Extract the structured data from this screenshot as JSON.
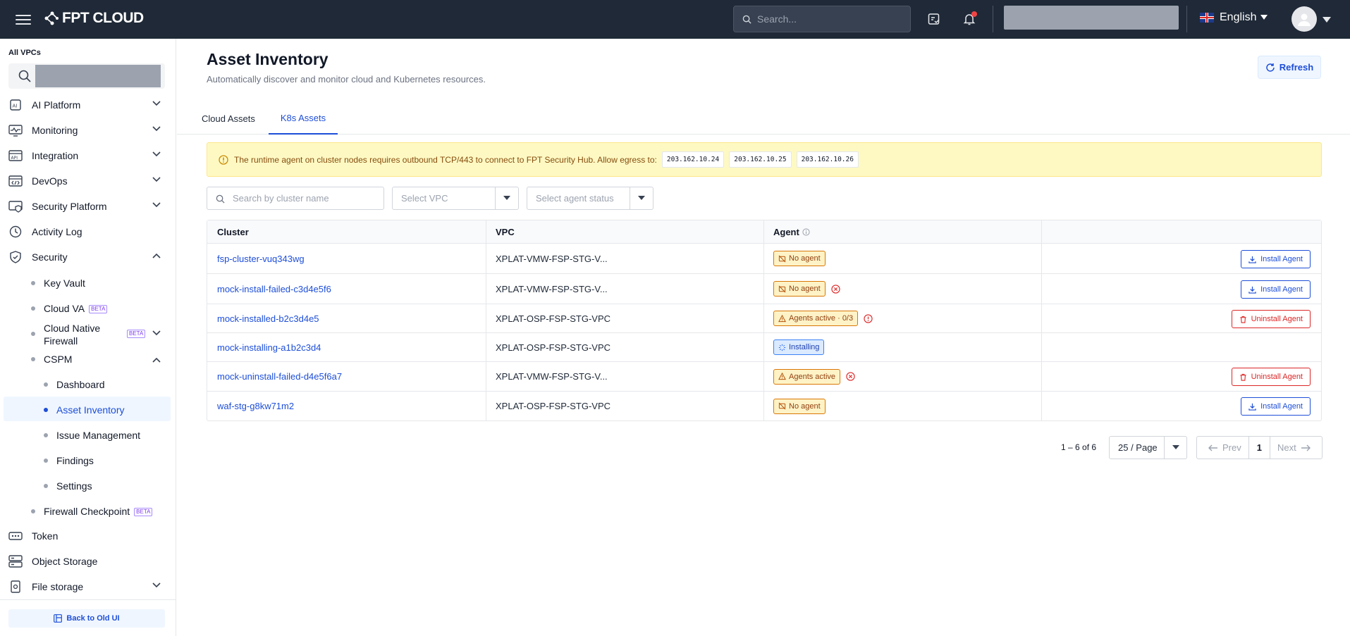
{
  "topbar": {
    "brand": "FPT CLOUD",
    "search_placeholder": "Search...",
    "language": "English"
  },
  "sidebar": {
    "scope_label": "All VPCs",
    "items": [
      {
        "label": "AI Platform",
        "icon": "ai-icon"
      },
      {
        "label": "Monitoring",
        "icon": "monitor-icon"
      },
      {
        "label": "Integration",
        "icon": "api-icon"
      },
      {
        "label": "DevOps",
        "icon": "code-icon"
      },
      {
        "label": "Security Platform",
        "icon": "security-platform-icon"
      },
      {
        "label": "Activity Log",
        "icon": "clock-icon"
      },
      {
        "label": "Security",
        "icon": "shield-icon"
      }
    ],
    "security_sub": {
      "key_vault": "Key Vault",
      "cloud_va": "Cloud VA",
      "cnf_line1": "Cloud Native",
      "cnf_line2": "Firewall",
      "cspm": "CSPM",
      "firewall_checkpoint": "Firewall Checkpoint",
      "beta": "BETA"
    },
    "cspm_sub": [
      "Dashboard",
      "Asset Inventory",
      "Issue Management",
      "Findings",
      "Settings"
    ],
    "bottom_items": [
      {
        "label": "Token",
        "icon": "token-icon"
      },
      {
        "label": "Object Storage",
        "icon": "storage-icon"
      },
      {
        "label": "File storage",
        "icon": "file-storage-icon"
      }
    ],
    "back_label": "Back to Old UI"
  },
  "page": {
    "title": "Asset Inventory",
    "subtitle": "Automatically discover and monitor cloud and Kubernetes resources.",
    "refresh_label": "Refresh",
    "tabs": [
      "Cloud Assets",
      "K8s Assets"
    ],
    "active_tab": "K8s Assets"
  },
  "alert": {
    "text": "The runtime agent on cluster nodes requires outbound TCP/443 to connect to FPT Security Hub. Allow egress to:",
    "ips": [
      "203.162.10.24",
      "203.162.10.25",
      "203.162.10.26"
    ]
  },
  "filters": {
    "cluster_placeholder": "Search by cluster name",
    "vpc_placeholder": "Select VPC",
    "status_placeholder": "Select agent status"
  },
  "table": {
    "headers": [
      "Cluster",
      "VPC",
      "Agent"
    ],
    "rows": [
      {
        "cluster": "fsp-cluster-vuq343wg",
        "vpc": "XPLAT-VMW-FSP-STG-V...",
        "agent": "No agent",
        "agent_kind": "warn",
        "status_icon": "",
        "action": "Install Agent"
      },
      {
        "cluster": "mock-install-failed-c3d4e5f6",
        "vpc": "XPLAT-VMW-FSP-STG-V...",
        "agent": "No agent",
        "agent_kind": "warn",
        "status_icon": "error",
        "action": "Install Agent"
      },
      {
        "cluster": "mock-installed-b2c3d4e5",
        "vpc": "XPLAT-OSP-FSP-STG-VPC",
        "agent": "Agents active · 0/3",
        "agent_kind": "warn",
        "status_icon": "info",
        "action": "Uninstall Agent"
      },
      {
        "cluster": "mock-installing-a1b2c3d4",
        "vpc": "XPLAT-OSP-FSP-STG-VPC",
        "agent": "Installing",
        "agent_kind": "info",
        "status_icon": "",
        "action": ""
      },
      {
        "cluster": "mock-uninstall-failed-d4e5f6a7",
        "vpc": "XPLAT-VMW-FSP-STG-V...",
        "agent": "Agents active",
        "agent_kind": "warn",
        "status_icon": "error",
        "action": "Uninstall Agent"
      },
      {
        "cluster": "waf-stg-g8kw71m2",
        "vpc": "XPLAT-OSP-FSP-STG-VPC",
        "agent": "No agent",
        "agent_kind": "warn",
        "status_icon": "",
        "action": "Install Agent"
      }
    ]
  },
  "pagination": {
    "range": "1 – 6 of 6",
    "per_page": "25 / Page",
    "prev": "Prev",
    "current": "1",
    "next": "Next"
  },
  "colors": {
    "topbar": "#1f2937",
    "accent": "#1d4ed8",
    "danger": "#dc2626",
    "warning": "#d97706"
  }
}
